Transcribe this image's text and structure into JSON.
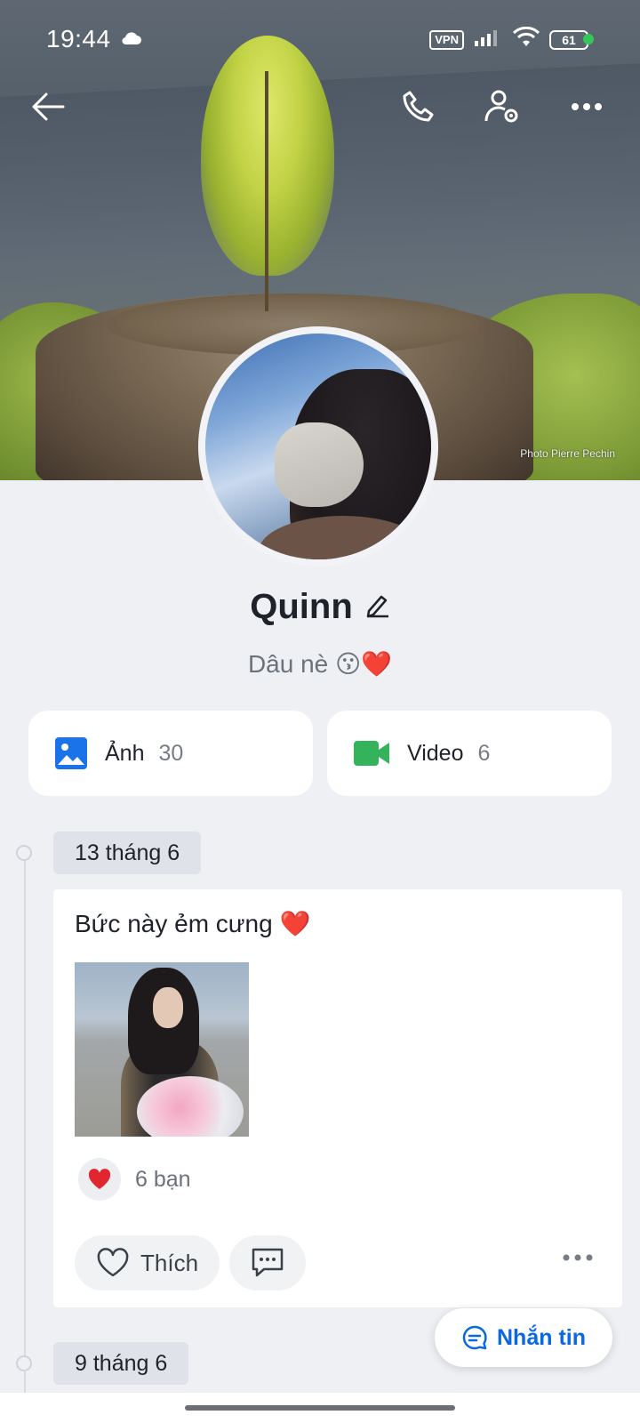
{
  "status_bar": {
    "time": "19:44",
    "vpn": "VPN",
    "battery": "61"
  },
  "cover": {
    "credit": "Photo Pierre Pechin"
  },
  "profile": {
    "name": "Quinn",
    "status": "Dâu nè 😗❤️"
  },
  "media": {
    "photos_label": "Ảnh",
    "photos_count": "30",
    "videos_label": "Video",
    "videos_count": "6"
  },
  "timeline": {
    "dates": [
      "13 tháng 6",
      "9 tháng 6"
    ],
    "post": {
      "text": "Bức này ẻm cưng ❤️",
      "reactions": "6 bạn",
      "like_label": "Thích"
    }
  },
  "message_button": "Nhắn tin",
  "colors": {
    "accent": "#0a68e0",
    "photo_icon": "#1a73e8",
    "video_icon": "#34b35a",
    "heart": "#e0262f"
  },
  "icons": [
    "cloud-icon",
    "signal-icon",
    "wifi-icon",
    "back-arrow-icon",
    "phone-icon",
    "user-settings-icon",
    "more-icon",
    "edit-pencil-icon",
    "photo-icon",
    "video-icon",
    "heart-icon",
    "comment-icon",
    "chat-icon"
  ]
}
